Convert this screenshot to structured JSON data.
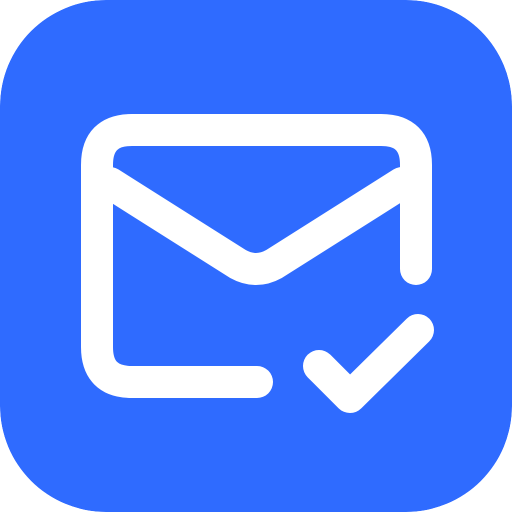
{
  "icon": {
    "name": "mail-checkmark-icon",
    "background_color": "#2F6BFF",
    "foreground_color": "#FFFFFF"
  }
}
